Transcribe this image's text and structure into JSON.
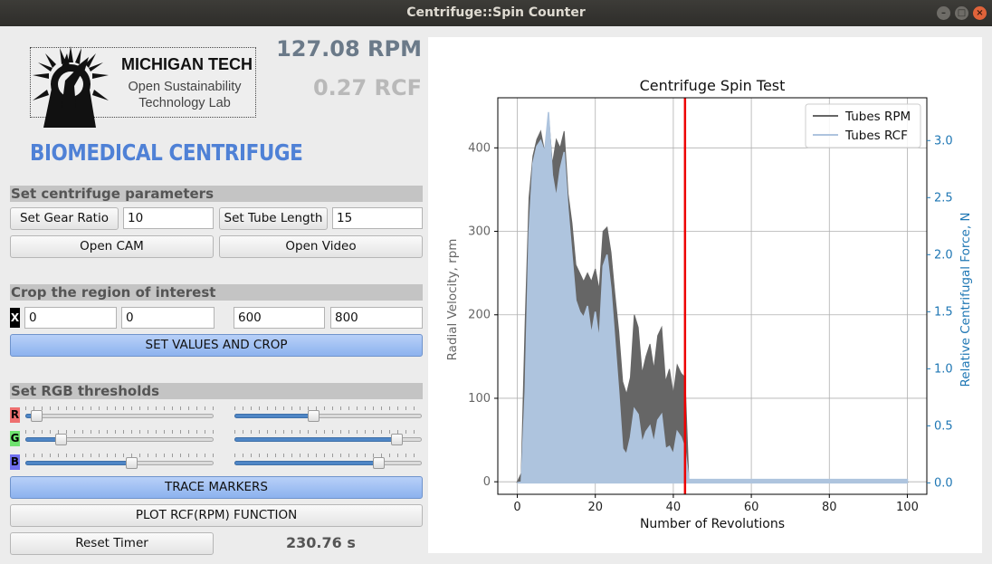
{
  "window": {
    "title": "Centrifuge::Spin Counter"
  },
  "logo": {
    "title": "MICHIGAN TECH",
    "subtitle_line1": "Open Sustainability",
    "subtitle_line2": "Technology Lab"
  },
  "app_title": "BIOMEDICAL CENTRIFUGE",
  "readouts": {
    "rpm": "127.08 RPM",
    "rcf": "0.27 RCF",
    "timer": "230.76 s"
  },
  "params": {
    "section_label": "Set centrifuge parameters",
    "gear_ratio_button": "Set Gear Ratio",
    "gear_ratio_value": "10",
    "tube_length_button": "Set Tube Length",
    "tube_length_value": "15",
    "open_cam_button": "Open CAM",
    "open_video_button": "Open Video"
  },
  "crop": {
    "section_label": "Crop the region of interest",
    "x_label": "X",
    "values": [
      "0",
      "0",
      "600",
      "800"
    ],
    "button": "SET VALUES AND CROP"
  },
  "rgb": {
    "section_label": "Set RGB thresholds",
    "channels": [
      {
        "label": "R",
        "color": "#ee6f6f",
        "left_value": 0.03,
        "right_value": 0.42
      },
      {
        "label": "G",
        "color": "#6fe26f",
        "left_value": 0.17,
        "right_value": 0.89
      },
      {
        "label": "B",
        "color": "#6f6fee",
        "left_value": 0.57,
        "right_value": 0.79
      }
    ]
  },
  "actions": {
    "trace_markers": "TRACE MARKERS",
    "plot_rcf": "PLOT RCF(RPM) FUNCTION",
    "reset_timer": "Reset Timer"
  },
  "chart_data": {
    "type": "area",
    "title": "Centrifuge Spin Test",
    "xlabel": "Number of Revolutions",
    "ylabel": "Radial Velocity, rpm",
    "y2label": "Relative Centrifugal Force, N",
    "xlim": [
      -5,
      105
    ],
    "ylim": [
      -15,
      460
    ],
    "y2lim": [
      -0.1,
      3.375
    ],
    "xticks": [
      "0",
      "20",
      "40",
      "60",
      "80",
      "100"
    ],
    "yticks": [
      "0",
      "100",
      "200",
      "300",
      "400"
    ],
    "y2ticks": [
      "0.0",
      "0.5",
      "1.0",
      "1.5",
      "2.0",
      "2.5",
      "3.0"
    ],
    "grid": true,
    "legend_position": "top-right",
    "vline_x": 43,
    "colors": {
      "rpm": "#666666",
      "rcf": "#aec4de",
      "vline": "#ee0000",
      "y2axis": "#1f77b4"
    },
    "series": [
      {
        "name": "Tubes RPM",
        "x": [
          0,
          1,
          2,
          3,
          4,
          5,
          6,
          7,
          8,
          9,
          10,
          11,
          12,
          13,
          14,
          15,
          16,
          17,
          18,
          19,
          20,
          21,
          22,
          23,
          24,
          25,
          26,
          27,
          28,
          29,
          30,
          31,
          32,
          33,
          34,
          35,
          36,
          37,
          38,
          39,
          40,
          41,
          42,
          43,
          44,
          45,
          50,
          60,
          70,
          80,
          90,
          100
        ],
        "values": [
          0,
          10,
          190,
          340,
          390,
          410,
          420,
          395,
          440,
          380,
          410,
          400,
          420,
          345,
          310,
          260,
          250,
          240,
          250,
          240,
          255,
          230,
          300,
          305,
          275,
          225,
          180,
          120,
          105,
          125,
          200,
          185,
          130,
          150,
          165,
          135,
          175,
          185,
          120,
          135,
          105,
          140,
          130,
          125,
          0,
          0,
          0,
          0,
          0,
          0,
          0,
          0
        ]
      },
      {
        "name": "Tubes RCF",
        "x": [
          0,
          1,
          2,
          3,
          4,
          5,
          6,
          7,
          8,
          9,
          10,
          11,
          12,
          13,
          14,
          15,
          16,
          17,
          18,
          19,
          20,
          21,
          22,
          23,
          24,
          25,
          26,
          27,
          28,
          29,
          30,
          31,
          32,
          33,
          34,
          35,
          36,
          37,
          38,
          39,
          40,
          41,
          42,
          43,
          44,
          45,
          50,
          60,
          70,
          80,
          90,
          100
        ],
        "values": [
          0,
          0.01,
          0.8,
          2.2,
          2.8,
          2.95,
          3.0,
          2.9,
          3.25,
          2.7,
          2.5,
          2.75,
          2.9,
          2.4,
          2.0,
          1.6,
          1.5,
          1.45,
          1.55,
          1.3,
          1.5,
          1.25,
          1.9,
          2.0,
          1.7,
          1.25,
          0.8,
          0.3,
          0.25,
          0.4,
          0.65,
          0.6,
          0.35,
          0.45,
          0.5,
          0.35,
          0.55,
          0.6,
          0.3,
          0.32,
          0.25,
          0.45,
          0.4,
          0.3,
          0.03,
          0.03,
          0.03,
          0.03,
          0.03,
          0.03,
          0.03,
          0.03
        ]
      }
    ]
  }
}
